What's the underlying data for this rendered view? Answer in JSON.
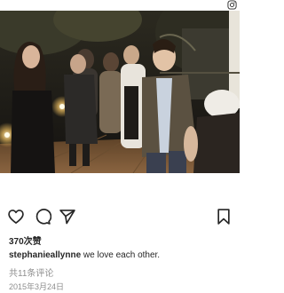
{
  "icons": {
    "instagram": "instagram-icon",
    "like": "heart-icon",
    "comment": "comment-icon",
    "share": "send-icon",
    "save": "bookmark-icon"
  },
  "post": {
    "likes": "370次赞",
    "username": "stephanieallynne",
    "caption": "we love each other.",
    "comments": "共11条评论",
    "date": "2015年3月24日"
  },
  "colors": {
    "text": "#262626",
    "muted": "#8e8e8e",
    "background": "#ffffff"
  }
}
